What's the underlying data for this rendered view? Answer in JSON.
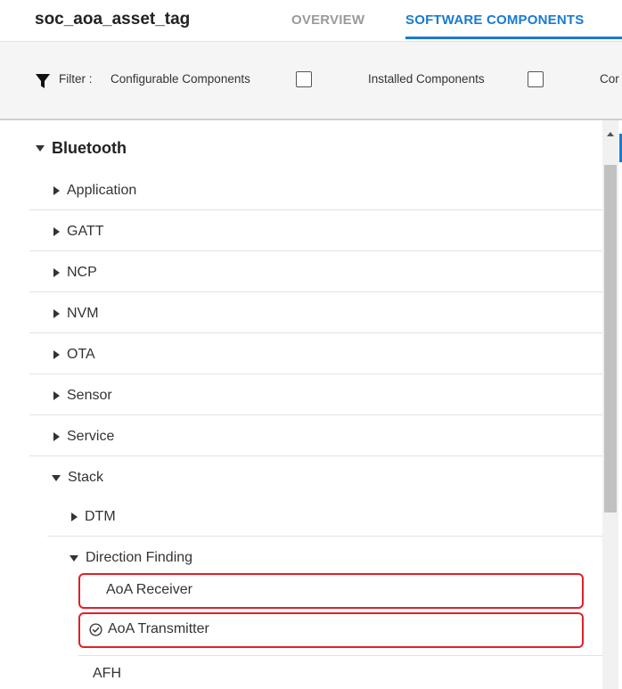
{
  "header": {
    "project_title": "soc_aoa_asset_tag",
    "tabs": [
      {
        "label": "OVERVIEW",
        "active": false
      },
      {
        "label": "SOFTWARE COMPONENTS",
        "active": true
      }
    ]
  },
  "filter_bar": {
    "filter_label": "Filter :",
    "configurable_label": "Configurable Components",
    "configurable_checked": false,
    "installed_label": "Installed Components",
    "installed_checked": false,
    "cut_off_label": "Cor"
  },
  "tree": {
    "root": {
      "label": "Bluetooth",
      "expanded": true
    },
    "children": [
      {
        "label": "Application",
        "expanded": false
      },
      {
        "label": "GATT",
        "expanded": false
      },
      {
        "label": "NCP",
        "expanded": false
      },
      {
        "label": "NVM",
        "expanded": false
      },
      {
        "label": "OTA",
        "expanded": false
      },
      {
        "label": "Sensor",
        "expanded": false
      },
      {
        "label": "Service",
        "expanded": false
      },
      {
        "label": "Stack",
        "expanded": true
      }
    ],
    "stack_children": [
      {
        "label": "DTM",
        "expanded": false
      },
      {
        "label": "Direction Finding",
        "expanded": true
      }
    ],
    "direction_finding_children": [
      {
        "label": "AoA Receiver",
        "installed": false,
        "highlighted": true
      },
      {
        "label": "AoA Transmitter",
        "installed": true,
        "highlighted": true
      }
    ],
    "after": [
      {
        "label": "AFH"
      }
    ]
  },
  "colors": {
    "accent": "#1a7bd0",
    "highlight": "#e0202a",
    "filter_bg": "#f5f5f5"
  },
  "icons": {
    "filter": "funnel-icon",
    "installed": "check-circle-icon",
    "collapsed": "triangle-right-icon",
    "expanded": "triangle-down-icon"
  }
}
